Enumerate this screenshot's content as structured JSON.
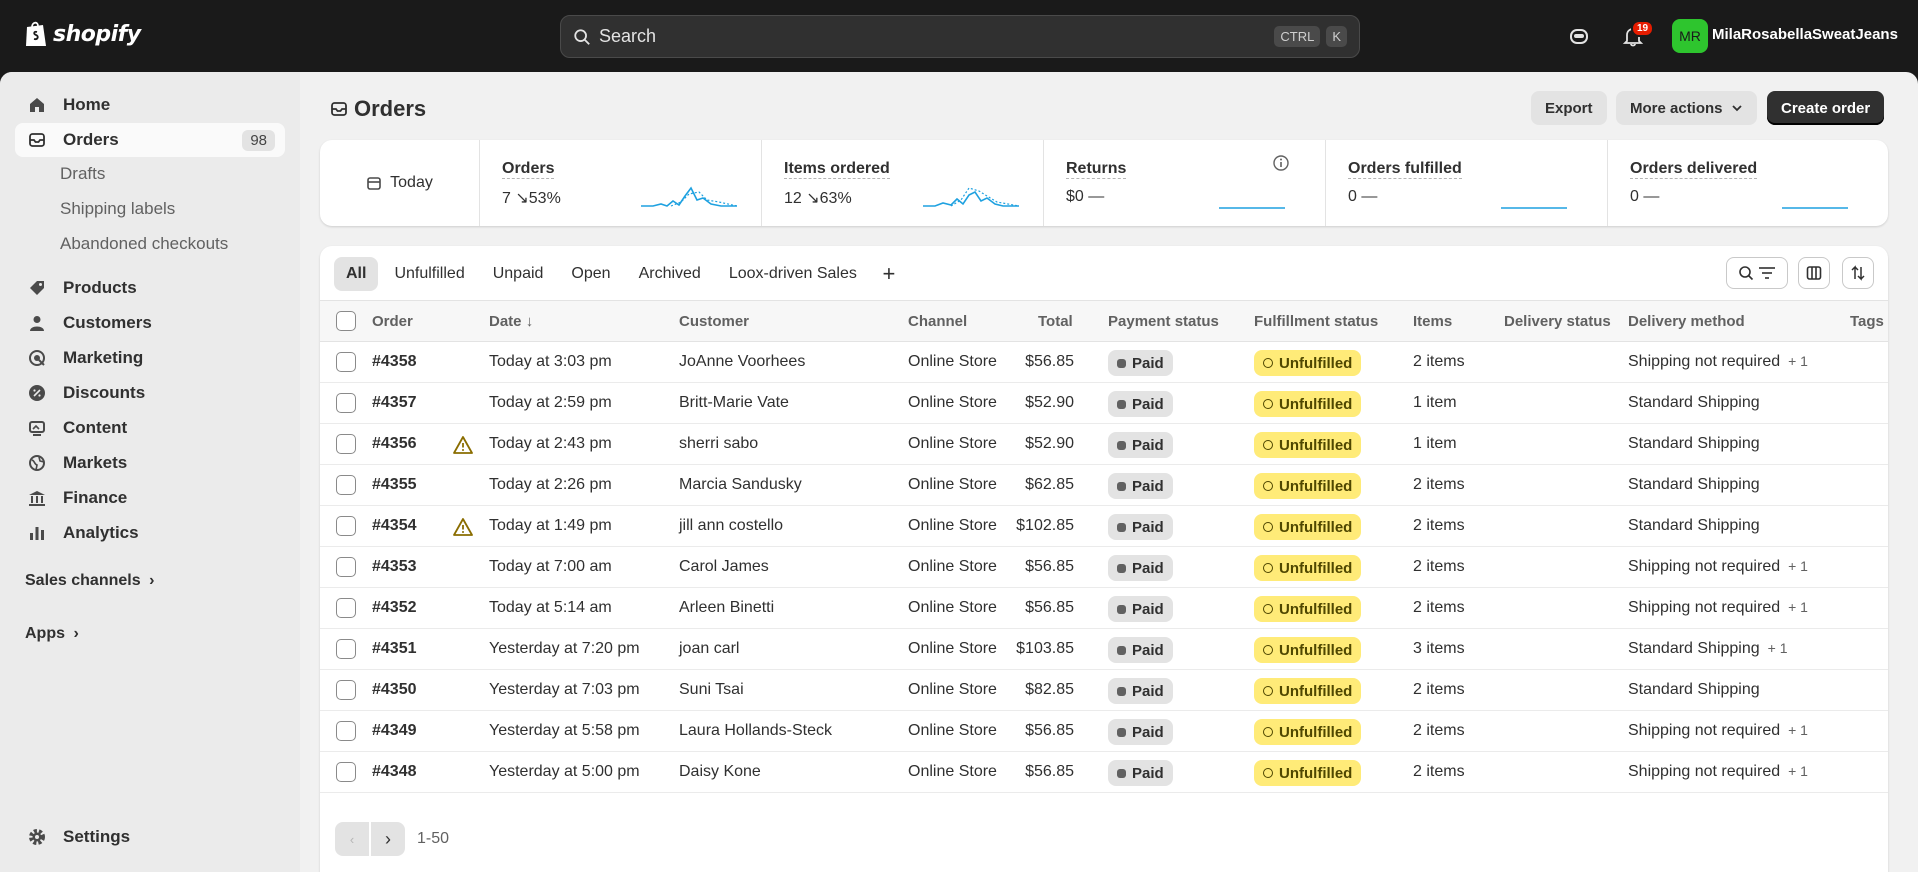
{
  "topbar": {
    "brand": "shopify",
    "search_placeholder": "Search",
    "shortcut_ctrl": "CTRL",
    "shortcut_key": "K",
    "notification_count": "19",
    "avatar_initials": "MR",
    "store_name": "MilaRosabellaSweatJeans"
  },
  "sidebar": {
    "home": "Home",
    "orders": "Orders",
    "orders_count": "98",
    "drafts": "Drafts",
    "shipping_labels": "Shipping labels",
    "abandoned_checkouts": "Abandoned checkouts",
    "products": "Products",
    "customers": "Customers",
    "marketing": "Marketing",
    "discounts": "Discounts",
    "content": "Content",
    "markets": "Markets",
    "finance": "Finance",
    "analytics": "Analytics",
    "sales_channels": "Sales channels",
    "apps": "Apps",
    "settings": "Settings"
  },
  "page": {
    "title": "Orders",
    "export": "Export",
    "more_actions": "More actions",
    "create_order": "Create order"
  },
  "stats": {
    "date_range": "Today",
    "orders_label": "Orders",
    "orders_value": "7",
    "orders_change": "53%",
    "items_label": "Items ordered",
    "items_value": "12",
    "items_change": "63%",
    "returns_label": "Returns",
    "returns_value": "$0",
    "returns_change": "—",
    "fulfilled_label": "Orders fulfilled",
    "fulfilled_value": "0",
    "fulfilled_change": "—",
    "delivered_label": "Orders delivered",
    "delivered_value": "0",
    "delivered_change": "—"
  },
  "tabs": [
    "All",
    "Unfulfilled",
    "Unpaid",
    "Open",
    "Archived",
    "Loox-driven Sales"
  ],
  "columns": {
    "order": "Order",
    "date": "Date",
    "customer": "Customer",
    "channel": "Channel",
    "total": "Total",
    "payment_status": "Payment status",
    "fulfillment_status": "Fulfillment status",
    "items": "Items",
    "delivery_status": "Delivery status",
    "delivery_method": "Delivery method",
    "tags": "Tags"
  },
  "orders": [
    {
      "number": "#4358",
      "warning": false,
      "date": "Today at 3:03 pm",
      "customer": "JoAnne Voorhees",
      "channel": "Online Store",
      "total": "$56.85",
      "payment": "Paid",
      "fulfillment": "Unfulfilled",
      "items": "2 items",
      "delivery_method": "Shipping not required",
      "extra": "+ 1"
    },
    {
      "number": "#4357",
      "warning": false,
      "date": "Today at 2:59 pm",
      "customer": "Britt-Marie Vate",
      "channel": "Online Store",
      "total": "$52.90",
      "payment": "Paid",
      "fulfillment": "Unfulfilled",
      "items": "1 item",
      "delivery_method": "Standard Shipping",
      "extra": ""
    },
    {
      "number": "#4356",
      "warning": true,
      "date": "Today at 2:43 pm",
      "customer": "sherri sabo",
      "channel": "Online Store",
      "total": "$52.90",
      "payment": "Paid",
      "fulfillment": "Unfulfilled",
      "items": "1 item",
      "delivery_method": "Standard Shipping",
      "extra": ""
    },
    {
      "number": "#4355",
      "warning": false,
      "date": "Today at 2:26 pm",
      "customer": "Marcia Sandusky",
      "channel": "Online Store",
      "total": "$62.85",
      "payment": "Paid",
      "fulfillment": "Unfulfilled",
      "items": "2 items",
      "delivery_method": "Standard Shipping",
      "extra": ""
    },
    {
      "number": "#4354",
      "warning": true,
      "date": "Today at 1:49 pm",
      "customer": "jill ann costello",
      "channel": "Online Store",
      "total": "$102.85",
      "payment": "Paid",
      "fulfillment": "Unfulfilled",
      "items": "2 items",
      "delivery_method": "Standard Shipping",
      "extra": ""
    },
    {
      "number": "#4353",
      "warning": false,
      "date": "Today at 7:00 am",
      "customer": "Carol James",
      "channel": "Online Store",
      "total": "$56.85",
      "payment": "Paid",
      "fulfillment": "Unfulfilled",
      "items": "2 items",
      "delivery_method": "Shipping not required",
      "extra": "+ 1"
    },
    {
      "number": "#4352",
      "warning": false,
      "date": "Today at 5:14 am",
      "customer": "Arleen Binetti",
      "channel": "Online Store",
      "total": "$56.85",
      "payment": "Paid",
      "fulfillment": "Unfulfilled",
      "items": "2 items",
      "delivery_method": "Shipping not required",
      "extra": "+ 1"
    },
    {
      "number": "#4351",
      "warning": false,
      "date": "Yesterday at 7:20 pm",
      "customer": "joan carl",
      "channel": "Online Store",
      "total": "$103.85",
      "payment": "Paid",
      "fulfillment": "Unfulfilled",
      "items": "3 items",
      "delivery_method": "Standard Shipping",
      "extra": "+ 1"
    },
    {
      "number": "#4350",
      "warning": false,
      "date": "Yesterday at 7:03 pm",
      "customer": "Suni Tsai",
      "channel": "Online Store",
      "total": "$82.85",
      "payment": "Paid",
      "fulfillment": "Unfulfilled",
      "items": "2 items",
      "delivery_method": "Standard Shipping",
      "extra": ""
    },
    {
      "number": "#4349",
      "warning": false,
      "date": "Yesterday at 5:58 pm",
      "customer": "Laura Hollands-Steck",
      "channel": "Online Store",
      "total": "$56.85",
      "payment": "Paid",
      "fulfillment": "Unfulfilled",
      "items": "2 items",
      "delivery_method": "Shipping not required",
      "extra": "+ 1"
    },
    {
      "number": "#4348",
      "warning": false,
      "date": "Yesterday at 5:00 pm",
      "customer": "Daisy Kone",
      "channel": "Online Store",
      "total": "$56.85",
      "payment": "Paid",
      "fulfillment": "Unfulfilled",
      "items": "2 items",
      "delivery_method": "Shipping not required",
      "extra": "+ 1"
    }
  ],
  "pagination": {
    "range": "1-50"
  },
  "colors": {
    "topbar": "#1a1a1a",
    "unfulfilled": "#ffeb78",
    "avatar": "#2ec52e",
    "notification": "#e51c00",
    "sparkline": "#1ea1e0"
  },
  "icons": [
    "shopify-bag-icon",
    "search-icon",
    "sidekick-icon",
    "bell-icon",
    "home-icon",
    "orders-icon",
    "products-icon",
    "customers-icon",
    "marketing-icon",
    "discounts-icon",
    "content-icon",
    "markets-icon",
    "finance-icon",
    "analytics-icon",
    "settings-icon",
    "calendar-icon",
    "info-icon",
    "warning-icon",
    "filter-icon",
    "columns-icon",
    "sort-icon"
  ]
}
